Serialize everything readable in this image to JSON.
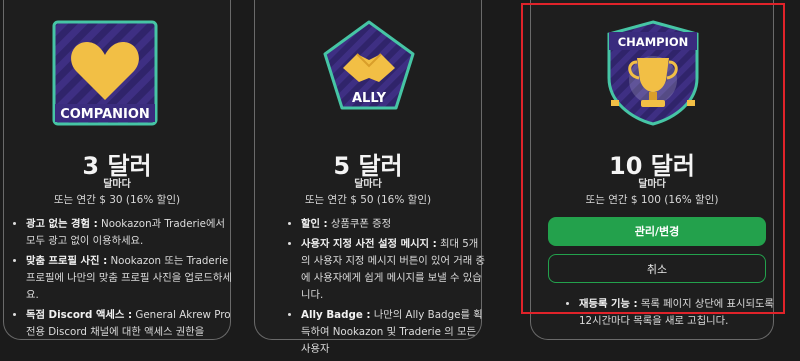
{
  "cards": [
    {
      "badge_label": "COMPANION",
      "price": "3 달러",
      "period": "달마다",
      "yearly": "또는 연간 $ 30 (16% 할인)",
      "features": [
        {
          "title": "광고 없는 경험 :",
          "text": " Nookazon과 Traderie에서 모두 광고 없이 이용하세요."
        },
        {
          "title": "맞춤 프로필 사진 :",
          "text": " Nookazon 또는 Traderie 프로필에 나만의 맞춤 프로필 사진을 업로드하세요."
        },
        {
          "title": "독점 Discord 액세스 :",
          "text": " General Akrew Pro 전용 Discord 채널에 대한 액세스 권한을"
        }
      ]
    },
    {
      "badge_label": "ALLY",
      "price": "5 달러",
      "period": "달마다",
      "yearly": "또는 연간 $ 50 (16% 할인)",
      "features": [
        {
          "title": "할인 :",
          "text": " 상품쿠폰 증정"
        },
        {
          "title": "사용자 지정 사전 설정 메시지 :",
          "text": " 최대 5개의 사용자 지정 메시지 버튼이 있어 거래 중에 사용자에게 쉽게 메시지를 보낼 수 있습니다."
        },
        {
          "title": "Ally Badge :",
          "text": " 나만의 Ally Badge를 획득하여 Nookazon 및 Traderie 의 모든 사용자"
        }
      ]
    },
    {
      "badge_label": "CHAMPION",
      "price": "10 달러",
      "period": "달마다",
      "yearly": "또는 연간 $ 100 (16% 할인)",
      "manage_button": "관리/변경",
      "cancel_button": "취소",
      "features": [
        {
          "title": "재등록 기능 :",
          "text": " 목록 페이지 상단에 표시되도록 12시간마다 목록을 새로 고칩니다."
        }
      ]
    }
  ],
  "colors": {
    "accent_green": "#23a14c",
    "highlight_red": "#e0232a",
    "badge_purple": "#3e2f83",
    "badge_gold": "#f2bf45"
  }
}
